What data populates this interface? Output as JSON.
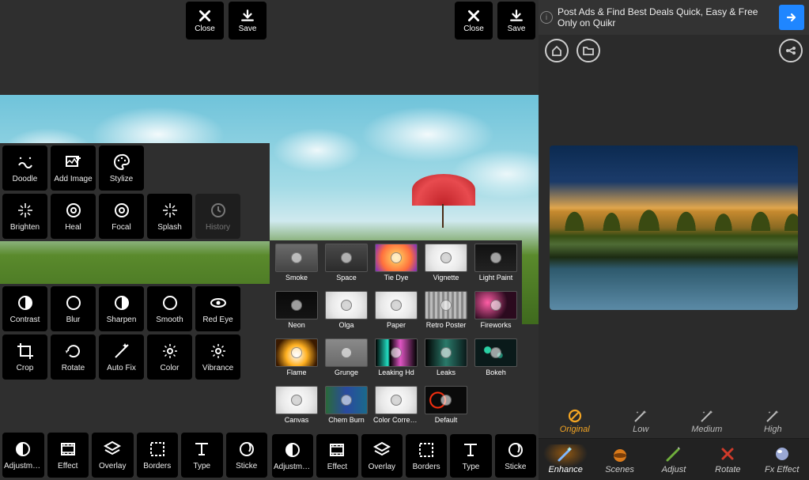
{
  "topbar": {
    "close": "Close",
    "save": "Save"
  },
  "left": {
    "upper": [
      {
        "id": "doodle",
        "label": "Doodle",
        "icon": "doodle-icon"
      },
      {
        "id": "add-image",
        "label": "Add Image",
        "icon": "add-image-icon"
      },
      {
        "id": "stylize",
        "label": "Stylize",
        "icon": "palette-icon"
      }
    ],
    "row2": [
      {
        "id": "brighten",
        "label": "Brighten",
        "icon": "sparkle-icon"
      },
      {
        "id": "heal",
        "label": "Heal",
        "icon": "target-icon"
      },
      {
        "id": "focal",
        "label": "Focal",
        "icon": "focal-icon"
      },
      {
        "id": "splash",
        "label": "Splash",
        "icon": "splash-icon"
      },
      {
        "id": "history",
        "label": "History",
        "icon": "history-icon",
        "dim": true
      }
    ],
    "grid": [
      {
        "id": "contrast",
        "label": "Contrast",
        "icon": "contrast-icon"
      },
      {
        "id": "blur",
        "label": "Blur",
        "icon": "blur-icon"
      },
      {
        "id": "sharpen",
        "label": "Sharpen",
        "icon": "sharpen-icon"
      },
      {
        "id": "smooth",
        "label": "Smooth",
        "icon": "smooth-icon"
      },
      {
        "id": "red-eye",
        "label": "Red Eye",
        "icon": "eye-icon"
      },
      {
        "id": "crop",
        "label": "Crop",
        "icon": "crop-icon"
      },
      {
        "id": "rotate",
        "label": "Rotate",
        "icon": "rotate-icon"
      },
      {
        "id": "auto-fix",
        "label": "Auto Fix",
        "icon": "magic-icon"
      },
      {
        "id": "color",
        "label": "Color",
        "icon": "color-icon"
      },
      {
        "id": "vibrance",
        "label": "Vibrance",
        "icon": "vibrance-icon"
      },
      {
        "id": "adjustment",
        "label": "Adjustment",
        "icon": "adjust-icon"
      },
      {
        "id": "effect",
        "label": "Effect",
        "icon": "film-icon"
      },
      {
        "id": "overlay",
        "label": "Overlay",
        "icon": "layers-icon"
      },
      {
        "id": "borders",
        "label": "Borders",
        "icon": "border-icon"
      },
      {
        "id": "type",
        "label": "Type",
        "icon": "type-icon"
      },
      {
        "id": "sticker",
        "label": "Sticke",
        "icon": "sticker-icon"
      }
    ]
  },
  "mid": {
    "effects": [
      {
        "id": "smoke",
        "label": "Smoke",
        "bg": "linear-gradient(#6b6b6b,#444)"
      },
      {
        "id": "space",
        "label": "Space",
        "bg": "linear-gradient(#4a4a4a,#2b2b2b)"
      },
      {
        "id": "tie-dye",
        "label": "Tie Dye",
        "bg": "radial-gradient(circle,#ffe066,#ff6f3c 60%,#7a2dc4)"
      },
      {
        "id": "vignette",
        "label": "Vignette",
        "bg": "",
        "white": true
      },
      {
        "id": "light-paint",
        "label": "Light Paint",
        "bg": "linear-gradient(#111,#222)"
      },
      {
        "id": "neon",
        "label": "Neon",
        "bg": "linear-gradient(#0a0a0a,#141414)"
      },
      {
        "id": "olga",
        "label": "Olga",
        "bg": "",
        "white": true
      },
      {
        "id": "paper",
        "label": "Paper",
        "bg": "",
        "white": true
      },
      {
        "id": "retro-poster",
        "label": "Retro Poster",
        "bg": "repeating-linear-gradient(90deg,#bbb 0 3px,#888 3px 6px)"
      },
      {
        "id": "fireworks",
        "label": "Fireworks",
        "bg": "radial-gradient(circle at 30% 40%,#ff5ea6,#2b0a1e 60%)"
      },
      {
        "id": "flame",
        "label": "Flame",
        "bg": "radial-gradient(circle at 50% 60%,#fff,#ffb020 40%,#3a1a00 80%)"
      },
      {
        "id": "grunge",
        "label": "Grunge",
        "bg": "linear-gradient(#8a8a8a,#6a6a6a)"
      },
      {
        "id": "leaking-hd",
        "label": "Leaking Hd",
        "bg": "linear-gradient(90deg,#000,#22e0c4 30%,#000 35%,#e055c4 60%,#000)"
      },
      {
        "id": "leaks",
        "label": "Leaks",
        "bg": "linear-gradient(90deg,#000,#2a7a6a 50%,#0a1a1a)"
      },
      {
        "id": "bokeh",
        "label": "Bokeh",
        "bg": "radial-gradient(circle at 30% 40%,#2ad1a4 0 4px,transparent 5px),radial-gradient(circle at 60% 60%,#1a8870 0 3px,transparent 4px),#0a1a1a"
      },
      {
        "id": "canvas",
        "label": "Canvas",
        "bg": "",
        "white": true
      },
      {
        "id": "chem-burn",
        "label": "Chem Burn",
        "bg": "linear-gradient(90deg,#2a6a3a,#2a4aa0 50%,#1a6a8a)"
      },
      {
        "id": "color-correction",
        "label": "Color Correction",
        "bg": "",
        "white": true
      },
      {
        "id": "default",
        "label": "Default",
        "bg": "radial-gradient(circle at 30% 50%,transparent 0 8px,#ff3010 9px 10px,transparent 11px),#0a0a0a"
      }
    ],
    "bottom": [
      {
        "id": "adjustment",
        "label": "Adjustment",
        "icon": "adjust-icon"
      },
      {
        "id": "effect",
        "label": "Effect",
        "icon": "film-icon"
      },
      {
        "id": "overlay",
        "label": "Overlay",
        "icon": "layers-icon"
      },
      {
        "id": "borders",
        "label": "Borders",
        "icon": "border-icon"
      },
      {
        "id": "type",
        "label": "Type",
        "icon": "type-icon"
      },
      {
        "id": "sticker",
        "label": "Sticke",
        "icon": "sticker-icon"
      }
    ]
  },
  "right": {
    "ad": {
      "text": "Post Ads & Find Best Deals Quick, Easy & Free Only on Quikr"
    },
    "levels": [
      {
        "id": "original",
        "label": "Original",
        "active": true,
        "icon": "no-icon"
      },
      {
        "id": "low",
        "label": "Low",
        "active": false,
        "icon": "wand-icon"
      },
      {
        "id": "medium",
        "label": "Medium",
        "active": false,
        "icon": "wand-icon"
      },
      {
        "id": "high",
        "label": "High",
        "active": false,
        "icon": "wand-icon"
      }
    ],
    "tabs": [
      {
        "id": "enhance",
        "label": "Enhance",
        "active": true
      },
      {
        "id": "scenes",
        "label": "Scenes",
        "active": false
      },
      {
        "id": "adjust",
        "label": "Adjust",
        "active": false
      },
      {
        "id": "rotate",
        "label": "Rotate",
        "active": false
      },
      {
        "id": "fx-effect",
        "label": "Fx Effect",
        "active": false
      }
    ]
  }
}
